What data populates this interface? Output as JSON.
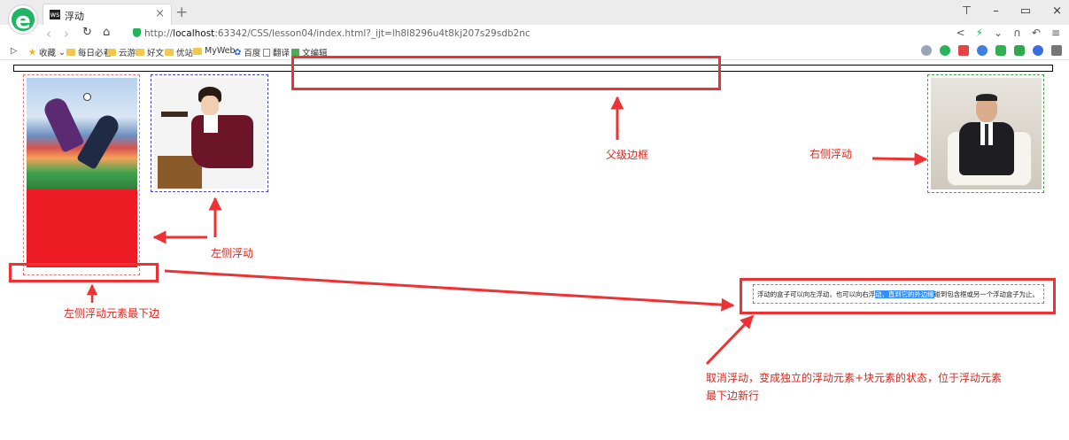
{
  "browser": {
    "logo": "e",
    "tab": {
      "favicon": "ws",
      "title": "浮动",
      "close": "×"
    },
    "new_tab": "+",
    "window_controls": [
      "⊤",
      "–",
      "▭",
      "×"
    ],
    "url_scheme": "http://",
    "url_host": "localhost",
    "url_rest": ":63342/CSS/lesson04/index.html?_ijt=lh8l8296u4t8kj207s29sdb2nc",
    "bookmarks": [
      "收藏",
      "每日必看",
      "云游",
      "好文",
      "优站",
      "MyWeb",
      "百度",
      "翻译",
      "文编辑"
    ],
    "nav_icons": [
      "sidebar-toggle-icon",
      "back-icon",
      "forward-icon",
      "reload-icon",
      "home-icon"
    ]
  },
  "content": {
    "clear_text_pre": "浮动的盒子可以向左浮动，也可以向右浮",
    "clear_text_hl": "动，直到它的外边缘",
    "clear_text_post": "碰到包含框或另一个浮动盒子为止。"
  },
  "annotations": {
    "parent_border": "父级边框",
    "right_float": "右侧浮动",
    "left_float": "左侧浮动",
    "left_float_bottom": "左侧浮动元素最下边",
    "clear_note_line1": "取消浮动，变成独立的浮动元素+块元素的状态，位于浮动元素",
    "clear_note_line2": "最下边新行"
  },
  "colors": {
    "annotation": "#ee3233",
    "highlight": "#3390ff",
    "float_red": "#ed1c24"
  }
}
